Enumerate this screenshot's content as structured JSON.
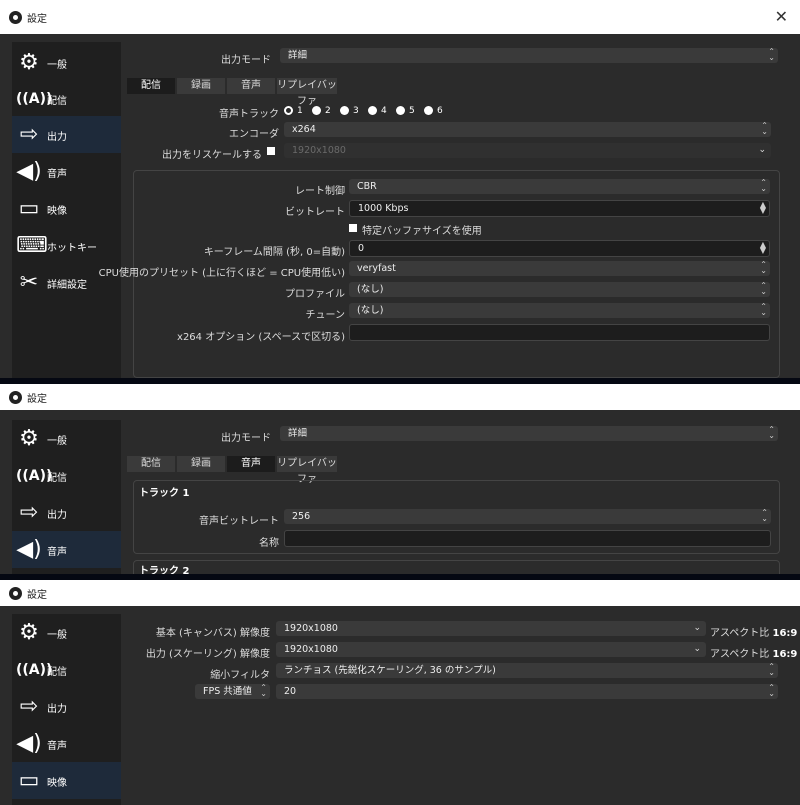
{
  "window_title": "設定",
  "close_glyph": "✕",
  "sidebar": {
    "general": "一般",
    "stream": "配信",
    "output": "出力",
    "audio": "音声",
    "video": "映像",
    "hotkeys": "ホットキー",
    "advanced": "詳細設定"
  },
  "output_mode": {
    "label": "出力モード",
    "value": "詳細"
  },
  "tabs": {
    "stream": "配信",
    "recording": "録画",
    "audio": "音声",
    "replay_buffer": "リプレイバッファ"
  },
  "panel1": {
    "audio_track_label": "音声トラック",
    "tracks": [
      "1",
      "2",
      "3",
      "4",
      "5",
      "6"
    ],
    "encoder_label": "エンコーダ",
    "encoder_value": "x264",
    "rescale_label": "出力をリスケールする",
    "rescale_value": "1920x1080",
    "rate_control_label": "レート制御",
    "rate_control_value": "CBR",
    "bitrate_label": "ビットレート",
    "bitrate_value": "1000 Kbps",
    "custom_buffer_label": "特定バッファサイズを使用",
    "keyframe_label": "キーフレーム間隔 (秒, 0=自動)",
    "keyframe_value": "0",
    "cpu_preset_label": "CPU使用のプリセット (上に行くほど = CPU使用低い)",
    "cpu_preset_value": "veryfast",
    "profile_label": "プロファイル",
    "profile_value": "(なし)",
    "tune_label": "チューン",
    "tune_value": "(なし)",
    "x264_options_label": "x264 オプション (スペースで区切る)",
    "x264_options_value": ""
  },
  "panel2": {
    "track1_title": "トラック 1",
    "audio_bitrate_label": "音声ビットレート",
    "audio_bitrate_value": "256",
    "name_label": "名称",
    "name_value": "",
    "track2_title": "トラック 2"
  },
  "panel3": {
    "base_res_label": "基本 (キャンバス) 解像度",
    "base_res_value": "1920x1080",
    "output_res_label": "出力 (スケーリング) 解像度",
    "output_res_value": "1920x1080",
    "aspect_label": "アスペクト比",
    "aspect_value": "16:9",
    "downscale_label": "縮小フィルタ",
    "downscale_value": "ランチョス (先鋭化スケーリング, 36 のサンプル)",
    "fps_type": "FPS 共通値",
    "fps_value": "20"
  }
}
